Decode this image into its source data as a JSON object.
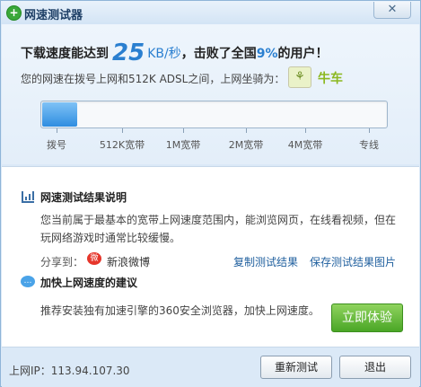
{
  "window": {
    "title": "网速测试器",
    "logo_glyph": "+",
    "close_glyph": "✕"
  },
  "speed": {
    "headline_prefix": "下载速度能达到",
    "speed_value": "25",
    "speed_unit": "KB/秒",
    "headline_middle": "，击败了全国",
    "percent": "9%",
    "headline_suffix": "的用户！",
    "compare_text": "您的网速在拨号上网和512K ADSL之间，上网坐骑为：",
    "vehicle_icon": "ox-icon",
    "vehicle_glyph": "⚘",
    "vehicle_label": "牛车",
    "progress_fraction": 0.1,
    "scale_labels": [
      "拨号",
      "512K宽带",
      "1M宽带",
      "2M宽带",
      "4M宽带",
      "专线"
    ]
  },
  "results": {
    "title": "网速测试结果说明",
    "description": "您当前属于最基本的宽带上网速度范围内，能浏览网页，在线看视频，但在玩网络游戏时通常比较缓慢。",
    "share_label": "分享到：",
    "weibo_label": "新浪微博",
    "weibo_glyph": "微",
    "copy_link": "复制测试结果",
    "save_link": "保存测试结果图片"
  },
  "advice": {
    "title": "加快上网速度的建议",
    "bubble_glyph": "…",
    "text": "推荐安装独有加速引擎的360安全浏览器，加快上网速度。",
    "try_button": "立即体验"
  },
  "footer": {
    "ip_label": "上网IP：113.94.107.30",
    "retest_button": "重新测试",
    "exit_button": "退出"
  },
  "colors": {
    "accent": "#2a7fd0",
    "progress": "#2f8de0",
    "vehicle": "#8cb820",
    "try_button": "#4aa626"
  }
}
